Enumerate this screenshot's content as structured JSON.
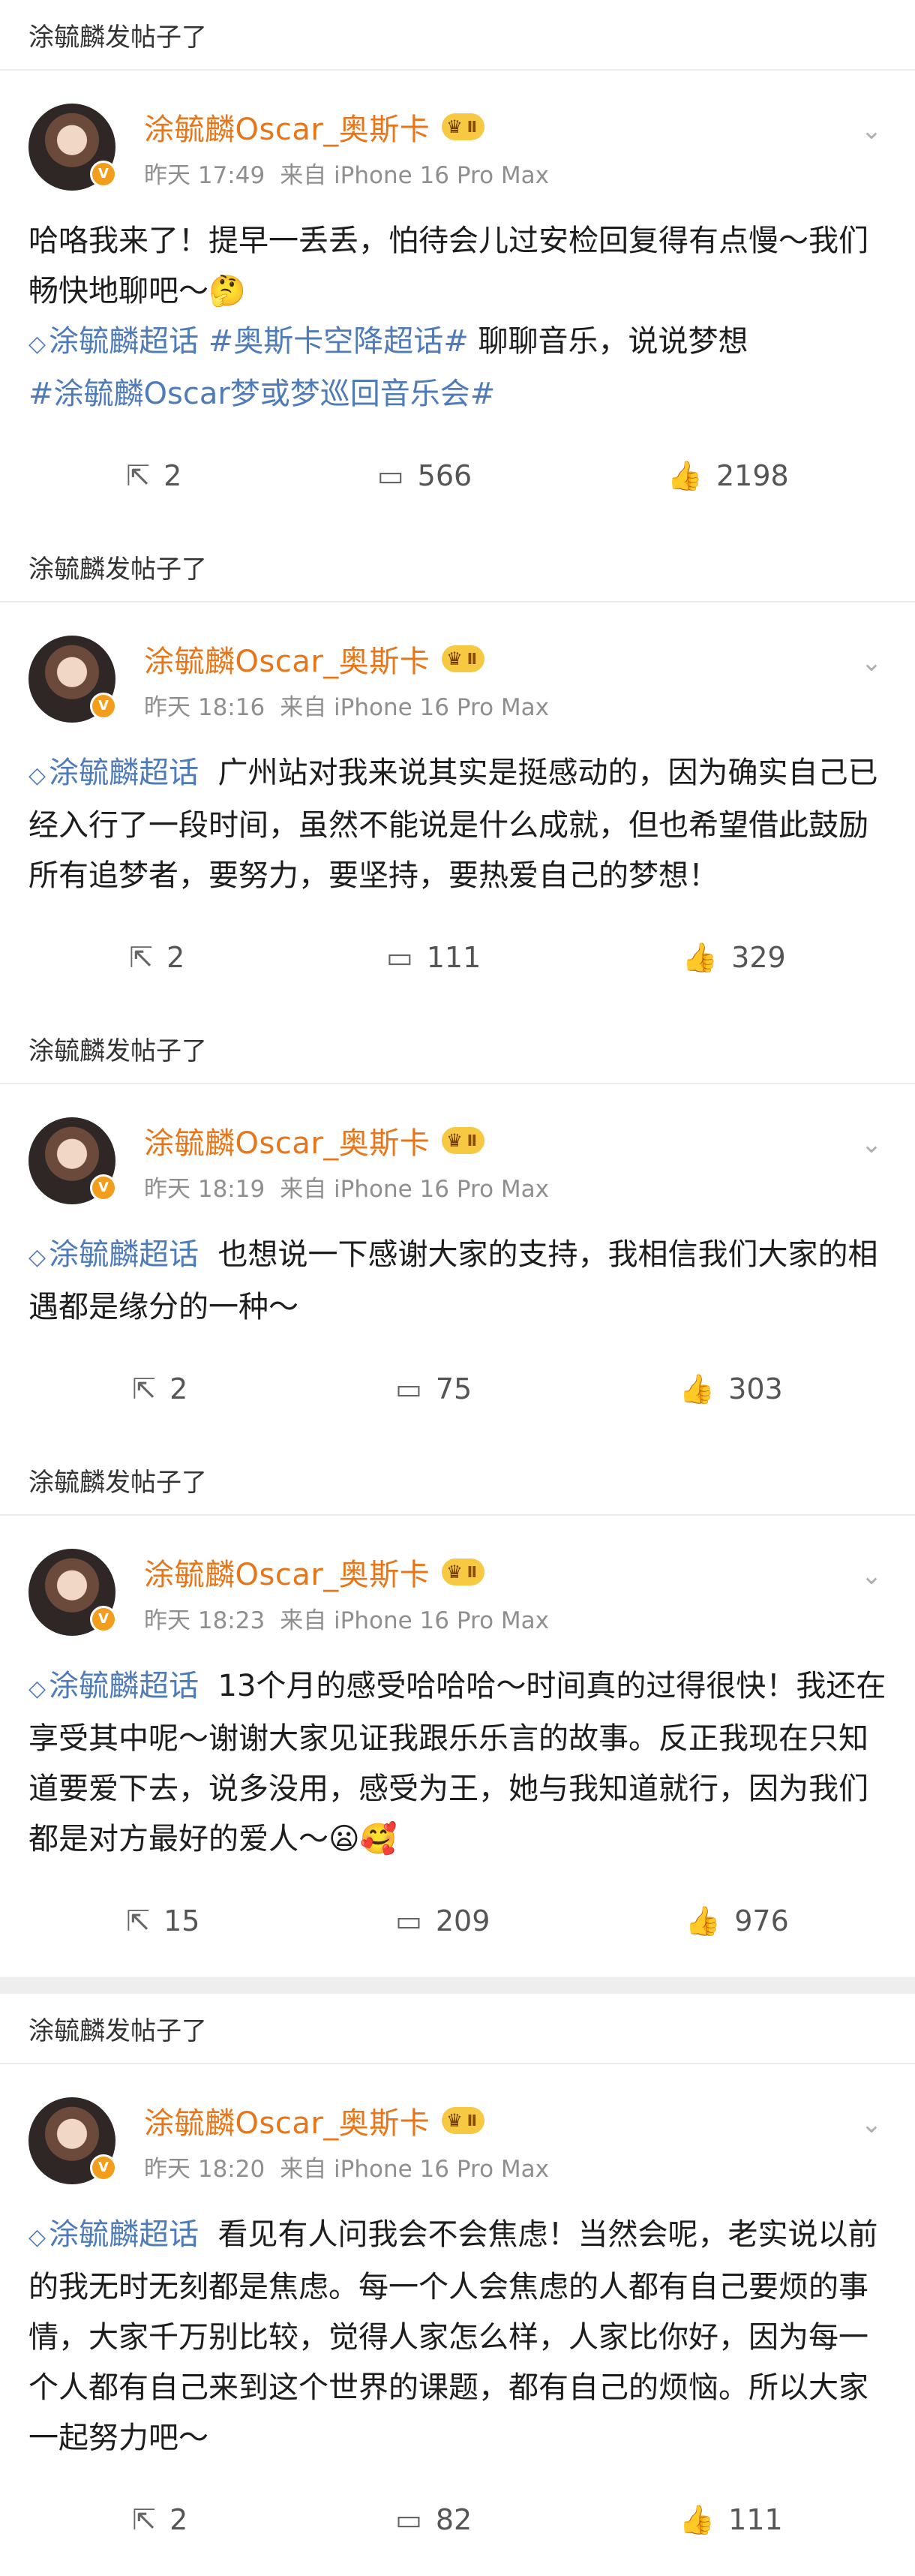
{
  "header_label": "涂毓麟发帖子了",
  "author": {
    "name": "涂毓麟Oscar_奥斯卡",
    "badge": "Ⅱ",
    "v_badge": "V"
  },
  "labels": {
    "from": "来自 iPhone 16 Pro Max"
  },
  "posts": [
    {
      "time": "昨天 17:49",
      "text_before": "哈咯我来了！提早一丢丢，怕待会儿过安检回复得有点慢～我们畅快地聊吧～🤔",
      "tag1": "涂毓麟超话",
      "tag2": "#奥斯卡空降超话#",
      "text_mid": " 聊聊音乐，说说梦想",
      "tag3": "#涂毓麟Oscar梦或梦巡回音乐会#",
      "reposts": "2",
      "comments": "566",
      "likes": "2198"
    },
    {
      "time": "昨天 18:16",
      "tag1": "涂毓麟超话",
      "text": "  广州站对我来说其实是挺感动的，因为确实自己已经入行了一段时间，虽然不能说是什么成就，但也希望借此鼓励所有追梦者，要努力，要坚持，要热爱自己的梦想！",
      "reposts": "2",
      "comments": "111",
      "likes": "329"
    },
    {
      "time": "昨天 18:19",
      "tag1": "涂毓麟超话",
      "text": "  也想说一下感谢大家的支持，我相信我们大家的相遇都是缘分的一种～",
      "reposts": "2",
      "comments": "75",
      "likes": "303"
    },
    {
      "time": "昨天 18:23",
      "tag1": "涂毓麟超话",
      "text": "  13个月的感受哈哈哈～时间真的过得很快！我还在享受其中呢～谢谢大家见证我跟乐乐言的故事。反正我现在只知道要爱下去，说多没用，感受为王，她与我知道就行，因为我们都是对方最好的爱人～😦🥰",
      "reposts": "15",
      "comments": "209",
      "likes": "976"
    },
    {
      "time": "昨天 18:20",
      "tag1": "涂毓麟超话",
      "text": "  看见有人问我会不会焦虑！当然会呢，老实说以前的我无时无刻都是焦虑。每一个人会焦虑的人都有自己要烦的事情，大家千万别比较，觉得人家怎么样，人家比你好，因为每一个人都有自己来到这个世界的课题，都有自己的烦恼。所以大家一起努力吧～",
      "reposts": "2",
      "comments": "82",
      "likes": "111"
    }
  ],
  "icons": {
    "repost": "share-icon",
    "comment": "comment-icon",
    "like": "thumbs-up-icon",
    "more": "chevron-down-icon",
    "tag": "diamond-icon"
  },
  "colors": {
    "name": "#e7761a",
    "tag": "#4f7bb8",
    "meta": "#8f8f8f"
  }
}
